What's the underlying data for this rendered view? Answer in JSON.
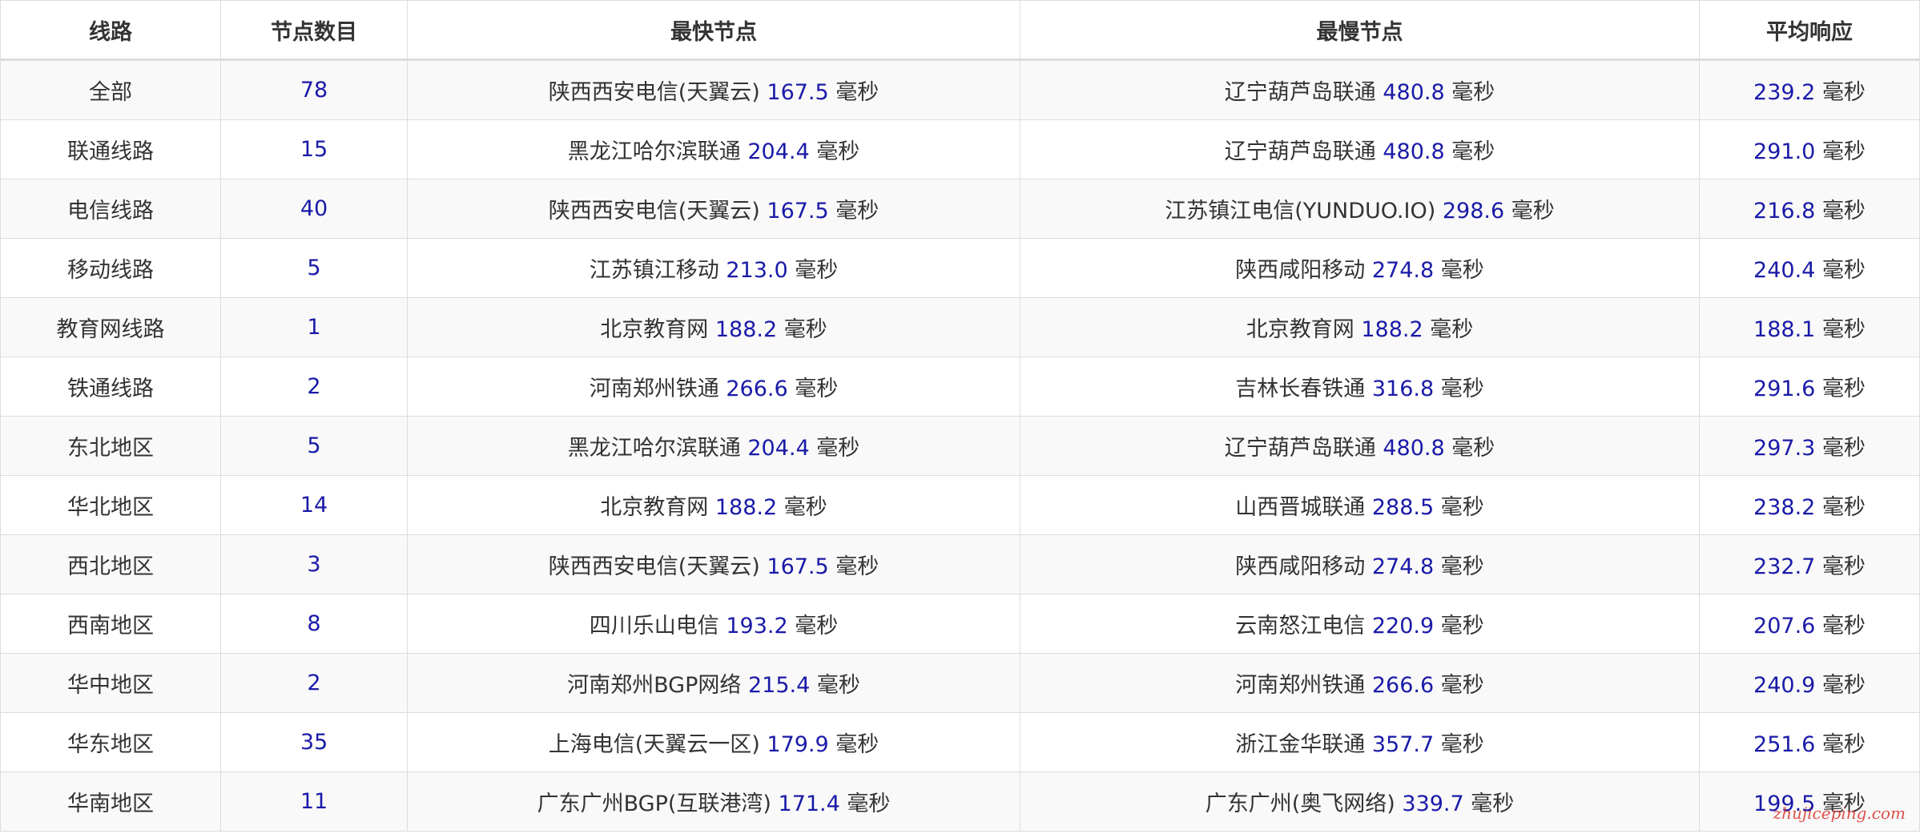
{
  "table": {
    "headers": [
      "线路",
      "节点数目",
      "最快节点",
      "最慢节点",
      "平均响应"
    ],
    "unit": "毫秒",
    "rows": [
      {
        "route": "全部",
        "count": "78",
        "fastest_name": "陕西西安电信(天翼云)",
        "fastest_ms": "167.5",
        "slowest_name": "辽宁葫芦岛联通",
        "slowest_ms": "480.8",
        "avg_ms": "239.2"
      },
      {
        "route": "联通线路",
        "count": "15",
        "fastest_name": "黑龙江哈尔滨联通",
        "fastest_ms": "204.4",
        "slowest_name": "辽宁葫芦岛联通",
        "slowest_ms": "480.8",
        "avg_ms": "291.0"
      },
      {
        "route": "电信线路",
        "count": "40",
        "fastest_name": "陕西西安电信(天翼云)",
        "fastest_ms": "167.5",
        "slowest_name": "江苏镇江电信(YUNDUO.IO)",
        "slowest_ms": "298.6",
        "avg_ms": "216.8"
      },
      {
        "route": "移动线路",
        "count": "5",
        "fastest_name": "江苏镇江移动",
        "fastest_ms": "213.0",
        "slowest_name": "陕西咸阳移动",
        "slowest_ms": "274.8",
        "avg_ms": "240.4"
      },
      {
        "route": "教育网线路",
        "count": "1",
        "fastest_name": "北京教育网",
        "fastest_ms": "188.2",
        "slowest_name": "北京教育网",
        "slowest_ms": "188.2",
        "avg_ms": "188.1"
      },
      {
        "route": "铁通线路",
        "count": "2",
        "fastest_name": "河南郑州铁通",
        "fastest_ms": "266.6",
        "slowest_name": "吉林长春铁通",
        "slowest_ms": "316.8",
        "avg_ms": "291.6"
      },
      {
        "route": "东北地区",
        "count": "5",
        "fastest_name": "黑龙江哈尔滨联通",
        "fastest_ms": "204.4",
        "slowest_name": "辽宁葫芦岛联通",
        "slowest_ms": "480.8",
        "avg_ms": "297.3"
      },
      {
        "route": "华北地区",
        "count": "14",
        "fastest_name": "北京教育网",
        "fastest_ms": "188.2",
        "slowest_name": "山西晋城联通",
        "slowest_ms": "288.5",
        "avg_ms": "238.2"
      },
      {
        "route": "西北地区",
        "count": "3",
        "fastest_name": "陕西西安电信(天翼云)",
        "fastest_ms": "167.5",
        "slowest_name": "陕西咸阳移动",
        "slowest_ms": "274.8",
        "avg_ms": "232.7"
      },
      {
        "route": "西南地区",
        "count": "8",
        "fastest_name": "四川乐山电信",
        "fastest_ms": "193.2",
        "slowest_name": "云南怒江电信",
        "slowest_ms": "220.9",
        "avg_ms": "207.6"
      },
      {
        "route": "华中地区",
        "count": "2",
        "fastest_name": "河南郑州BGP网络",
        "fastest_ms": "215.4",
        "slowest_name": "河南郑州铁通",
        "slowest_ms": "266.6",
        "avg_ms": "240.9"
      },
      {
        "route": "华东地区",
        "count": "35",
        "fastest_name": "上海电信(天翼云一区)",
        "fastest_ms": "179.9",
        "slowest_name": "浙江金华联通",
        "slowest_ms": "357.7",
        "avg_ms": "251.6"
      },
      {
        "route": "华南地区",
        "count": "11",
        "fastest_name": "广东广州BGP(互联港湾)",
        "fastest_ms": "171.4",
        "slowest_name": "广东广州(奥飞网络)",
        "slowest_ms": "339.7",
        "avg_ms": "199.5"
      }
    ]
  },
  "watermark": "zhujiceping.com",
  "colors": {
    "number": "#1a1aa8",
    "text": "#333333",
    "border": "#dddddd",
    "stripe": "#f9f9f9"
  }
}
